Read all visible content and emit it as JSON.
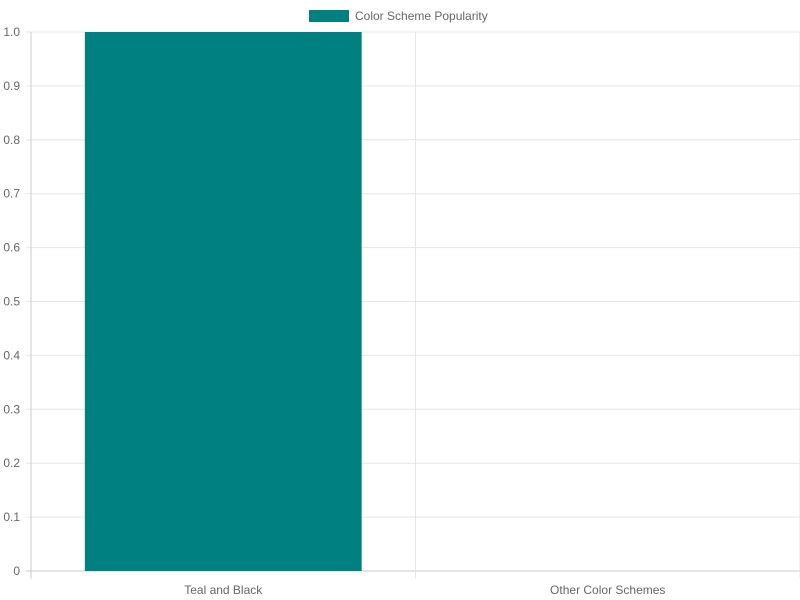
{
  "chart_data": {
    "type": "bar",
    "categories": [
      "Teal and Black",
      "Other Color Schemes"
    ],
    "series": [
      {
        "name": "Color Scheme Popularity",
        "values": [
          1.0,
          0
        ]
      }
    ],
    "ylim": [
      0,
      1.0
    ],
    "yticks": [
      "0",
      "0.1",
      "0.2",
      "0.3",
      "0.4",
      "0.5",
      "0.6",
      "0.7",
      "0.8",
      "0.9",
      "1.0"
    ],
    "grid": true,
    "legend_position": "top-center",
    "colors": {
      "bar": "#008080",
      "grid": "#e6e6e6",
      "axis": "#cccccc",
      "text": "#666666"
    }
  }
}
